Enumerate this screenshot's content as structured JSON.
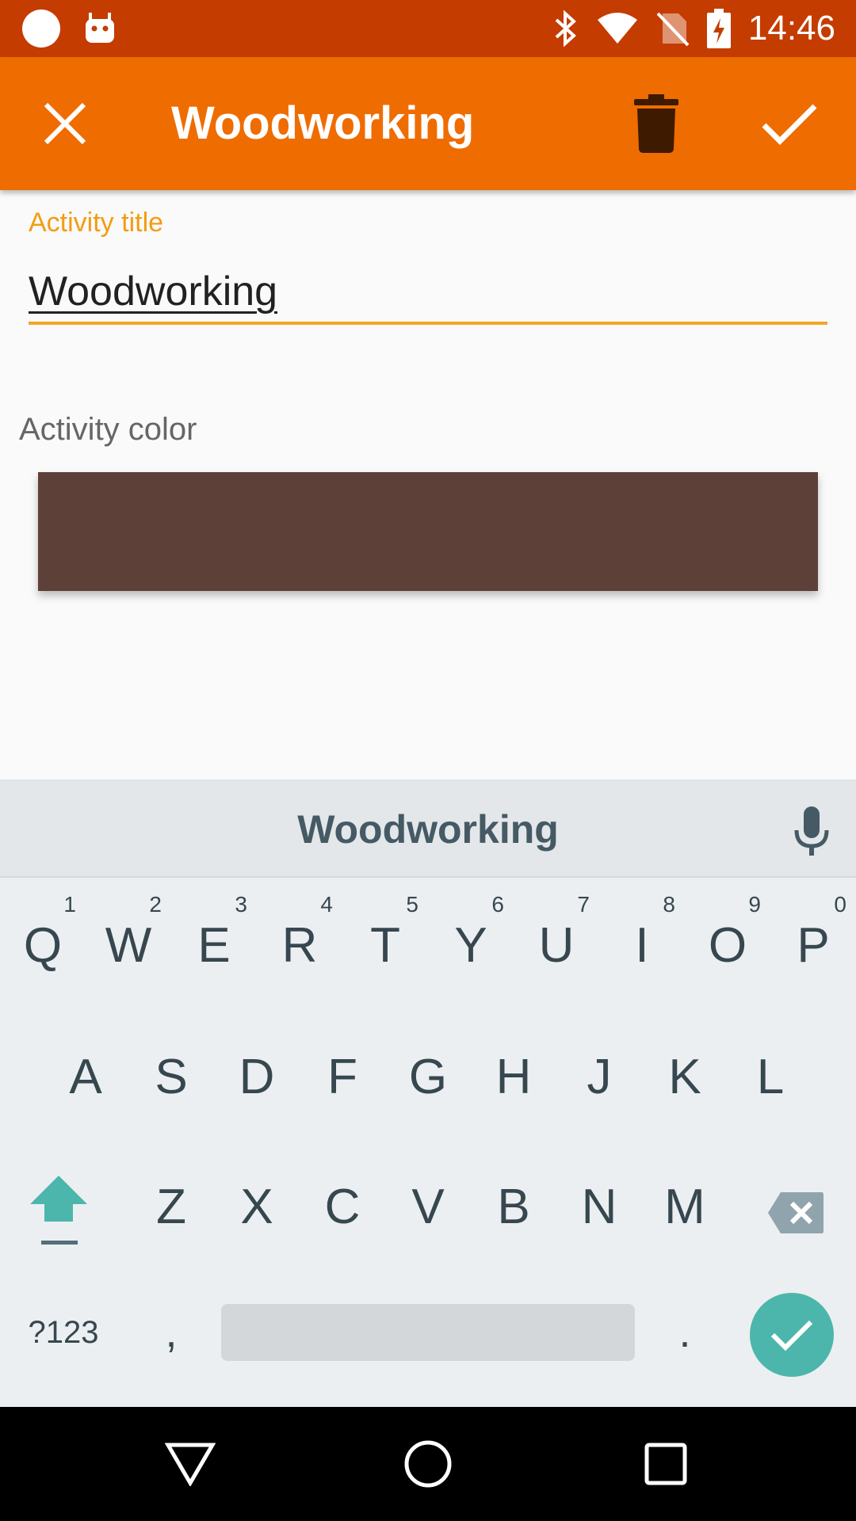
{
  "status_bar": {
    "time": "14:46",
    "icons": [
      "circle-notification-icon",
      "android-icon",
      "bluetooth-icon",
      "wifi-icon",
      "no-sim-icon",
      "battery-charging-icon"
    ]
  },
  "app_bar": {
    "title": "Woodworking",
    "close_icon": "close-icon",
    "delete_icon": "trash-icon",
    "confirm_icon": "check-icon"
  },
  "form": {
    "title_label": "Activity title",
    "title_value": "Woodworking",
    "color_label": "Activity color",
    "color_value": "#5d4037"
  },
  "colors": {
    "status_bar": "#c43c00",
    "app_bar": "#ef6c00",
    "accent": "#f5a623",
    "keyboard_accent": "#4db6ac"
  },
  "keyboard": {
    "suggestion": "Woodworking",
    "row1": [
      {
        "ch": "Q",
        "hint": "1"
      },
      {
        "ch": "W",
        "hint": "2"
      },
      {
        "ch": "E",
        "hint": "3"
      },
      {
        "ch": "R",
        "hint": "4"
      },
      {
        "ch": "T",
        "hint": "5"
      },
      {
        "ch": "Y",
        "hint": "6"
      },
      {
        "ch": "U",
        "hint": "7"
      },
      {
        "ch": "I",
        "hint": "8"
      },
      {
        "ch": "O",
        "hint": "9"
      },
      {
        "ch": "P",
        "hint": "0"
      }
    ],
    "row2": [
      "A",
      "S",
      "D",
      "F",
      "G",
      "H",
      "J",
      "K",
      "L"
    ],
    "row3": [
      "Z",
      "X",
      "C",
      "V",
      "B",
      "N",
      "M"
    ],
    "symbols_label": "?123",
    "comma_label": ",",
    "period_label": "."
  },
  "nav_bar": {
    "icons": [
      "back-icon",
      "home-icon",
      "recents-icon"
    ]
  }
}
